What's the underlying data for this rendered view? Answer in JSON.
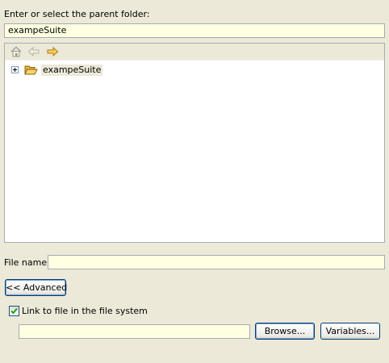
{
  "parent_folder": {
    "label": "Enter or select the parent folder:",
    "value": "exampeSuite"
  },
  "tree": {
    "toolbar_icons": [
      "home-icon",
      "back-arrow-icon",
      "forward-arrow-icon"
    ],
    "items": [
      {
        "label": "exampeSuite",
        "icon": "folder-open-icon",
        "expanded": false
      }
    ]
  },
  "file_name": {
    "label": "File name:",
    "value": ""
  },
  "advanced_button": {
    "label": "<< Advanced"
  },
  "link_checkbox": {
    "label": "Link to file in the file system",
    "checked": true
  },
  "link_path": {
    "value": ""
  },
  "browse_button": {
    "label": "Browse..."
  },
  "variables_button": {
    "label": "Variables..."
  },
  "colors": {
    "window_bg": "#ECE9D8",
    "field_bg": "#FFFFE1",
    "field_border": "#A5ACB5",
    "button_border": "#003C74",
    "checkmark": "#21A121",
    "folder": "#F5C542"
  }
}
